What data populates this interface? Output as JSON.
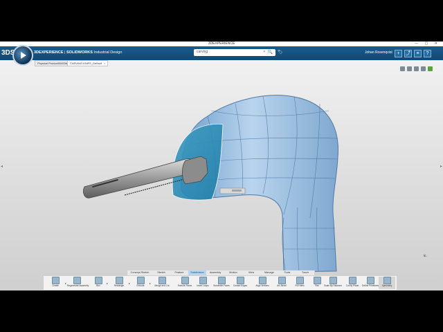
{
  "window": {
    "title": "3DEXPERIENCE",
    "controls": "— ▢ ✕"
  },
  "app": {
    "ds_logo": "3DS",
    "brand_prefix": "3DEXPERIENCE",
    "brand_sep": " | ",
    "brand_product": "SOLIDWORKS",
    "brand_suffix": " Industrial Design",
    "search_value": "carving",
    "search_clear": "✕",
    "search_icon": "🔍",
    "tag_icon": "🏷",
    "user_name": "Johan Rosenqvist",
    "top_buttons": [
      "+",
      "⤴",
      "≡",
      "?"
    ]
  },
  "tabs": [
    {
      "label": "Physical Product00453dz",
      "active": false
    },
    {
      "label": "CARVING KNIFE_Default",
      "active": true,
      "close": "×"
    }
  ],
  "nav_arrows": {
    "left": "◂",
    "right": "▸"
  },
  "axis_triad": "⟀",
  "command_tabs": [
    {
      "label": "Concept Sketch",
      "active": false
    },
    {
      "label": "Sketch",
      "active": false
    },
    {
      "label": "Feature",
      "active": false
    },
    {
      "label": "Subdivision",
      "active": true
    },
    {
      "label": "Assembly",
      "active": false
    },
    {
      "label": "Motion",
      "active": false
    },
    {
      "label": "View",
      "active": false
    },
    {
      "label": "Manage",
      "active": false
    },
    {
      "label": "Tools",
      "active": false
    },
    {
      "label": "Touch",
      "active": false
    }
  ],
  "actions": [
    {
      "label": "Create",
      "icon": "create-icon"
    },
    {
      "label": "Regenerate Assembly",
      "icon": "regenerate-icon"
    },
    {
      "label": "Box",
      "icon": "box-icon"
    },
    {
      "label": "Rectangle",
      "icon": "rectangle-icon"
    },
    {
      "label": "Extrude",
      "icon": "extrude-icon"
    },
    {
      "label": "Merge and Cut",
      "icon": "merge-cut-icon"
    },
    {
      "label": "Extrude Faces",
      "icon": "extrude-faces-icon"
    },
    {
      "label": "Insert Loops",
      "icon": "insert-loops-icon"
    },
    {
      "label": "Subdivide Faces",
      "icon": "subdivide-faces-icon"
    },
    {
      "label": "Crease Edges",
      "icon": "crease-edges-icon"
    },
    {
      "label": "Align Vertices",
      "icon": "align-vertices-icon"
    },
    {
      "label": "Arc Bevel",
      "icon": "arc-bevel-icon"
    },
    {
      "label": "Fill Holes",
      "icon": "fill-holes-icon"
    },
    {
      "label": "Flex",
      "icon": "flex-icon"
    },
    {
      "label": "Scale By Distance",
      "icon": "scale-icon"
    },
    {
      "label": "Cut By Plane",
      "icon": "cut-plane-icon"
    },
    {
      "label": "Define Primitives",
      "icon": "define-primitives-icon"
    },
    {
      "label": "Symmetry",
      "icon": "symmetry-icon"
    }
  ]
}
